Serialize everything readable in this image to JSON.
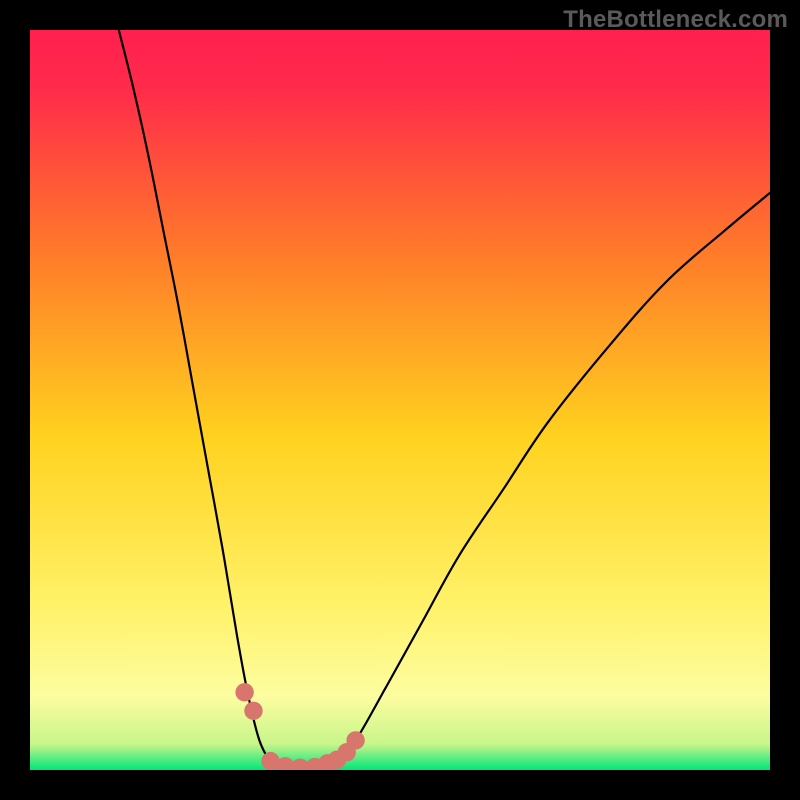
{
  "watermark": "TheBottleneck.com",
  "colors": {
    "frame_bg": "#000000",
    "grad_top": "#ff2050",
    "grad_mid_upper": "#ff7a2a",
    "grad_mid": "#ffd21f",
    "grad_lower": "#fff26a",
    "grad_pale": "#fdfda0",
    "grad_bottom": "#00e67a",
    "curve": "#000000",
    "dot": "#d8766d"
  },
  "chart_data": {
    "type": "line",
    "title": "",
    "xlabel": "",
    "ylabel": "",
    "xlim": [
      0,
      100
    ],
    "ylim": [
      0,
      100
    ],
    "series": [
      {
        "name": "left-branch",
        "x": [
          12,
          14,
          16,
          18,
          20,
          22,
          24,
          26,
          28,
          29.5,
          31,
          32.5
        ],
        "y": [
          100,
          92,
          83,
          73,
          63,
          52,
          41,
          30,
          18,
          10,
          4,
          1
        ]
      },
      {
        "name": "valley",
        "x": [
          32.5,
          34,
          36,
          38,
          40,
          41.5
        ],
        "y": [
          1,
          0.4,
          0.2,
          0.2,
          0.5,
          1.2
        ]
      },
      {
        "name": "right-branch",
        "x": [
          41.5,
          44,
          48,
          53,
          58,
          64,
          70,
          78,
          86,
          94,
          100
        ],
        "y": [
          1.2,
          4,
          11,
          20,
          29,
          38,
          47,
          57,
          66,
          73,
          78
        ]
      }
    ],
    "markers": {
      "name": "highlight-dots",
      "x": [
        29.0,
        30.2,
        32.5,
        34.5,
        36.5,
        38.5,
        40.2,
        41.5,
        42.8,
        44.0
      ],
      "y": [
        10.5,
        8.0,
        1.2,
        0.5,
        0.3,
        0.4,
        0.9,
        1.4,
        2.4,
        4.0
      ]
    },
    "gradient_stops": [
      {
        "pos": 0.0,
        "color": "#ff2050"
      },
      {
        "pos": 0.08,
        "color": "#ff2b4a"
      },
      {
        "pos": 0.3,
        "color": "#ff7a2a"
      },
      {
        "pos": 0.55,
        "color": "#ffd21f"
      },
      {
        "pos": 0.78,
        "color": "#fff26a"
      },
      {
        "pos": 0.9,
        "color": "#fdfda0"
      },
      {
        "pos": 0.965,
        "color": "#c8f58a"
      },
      {
        "pos": 1.0,
        "color": "#00e67a"
      }
    ]
  }
}
